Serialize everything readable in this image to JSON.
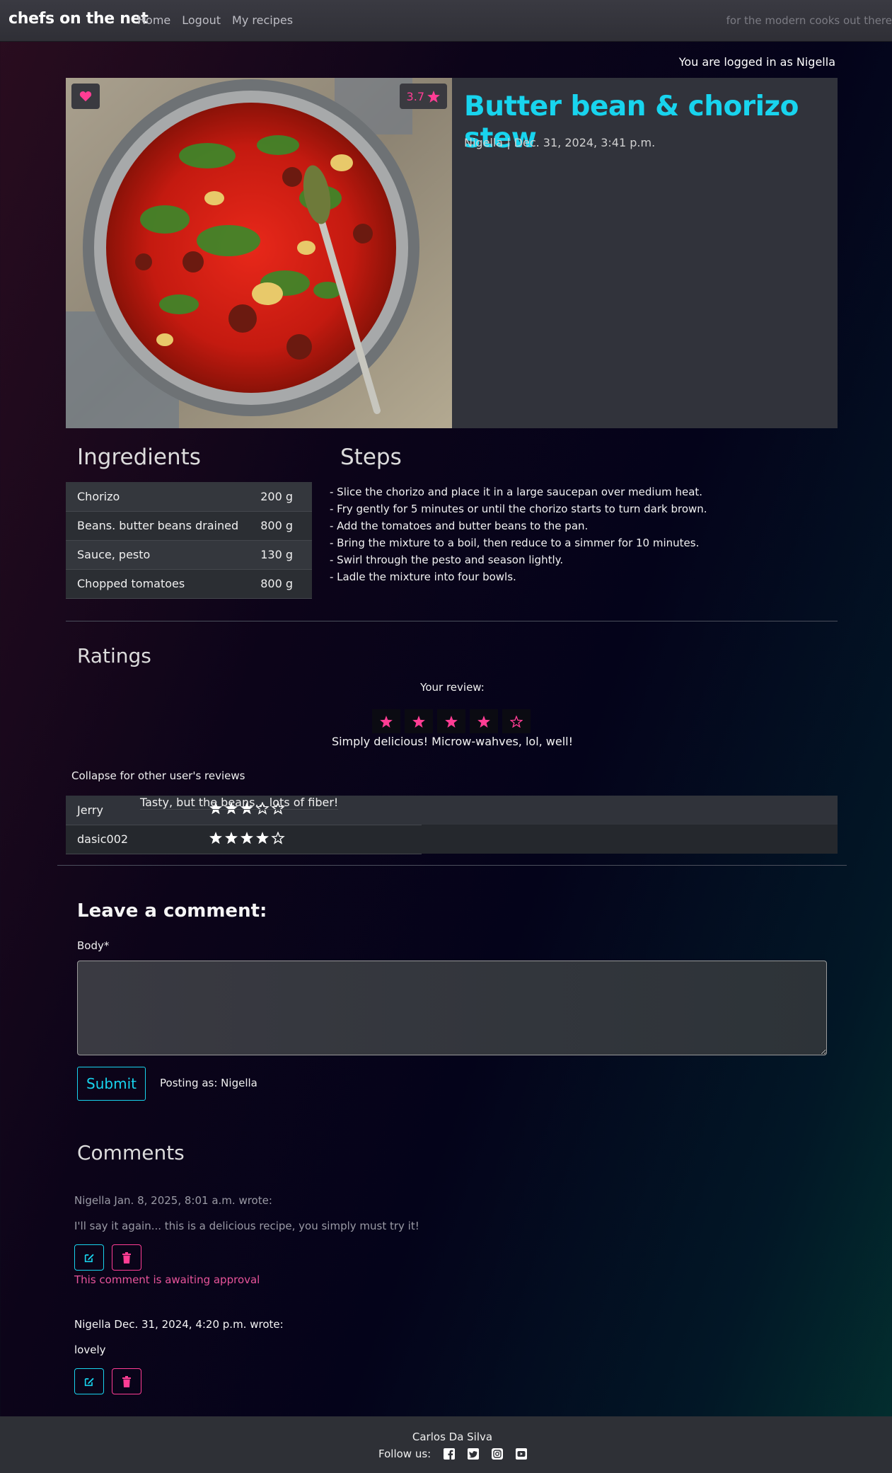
{
  "nav": {
    "brand": "chefs on the net",
    "links": [
      "Home",
      "Logout",
      "My recipes"
    ],
    "tagline": "for the modern cooks out there"
  },
  "session": {
    "logged_in_text": "You are logged in as Nigella"
  },
  "recipe": {
    "title": "Butter bean & chorizo stew",
    "meta": "Nigella | Dec. 31, 2024, 3:41 p.m.",
    "rating": "3.7",
    "image_icon": "heart-icon"
  },
  "ingredients": {
    "heading": "Ingredients",
    "items": [
      {
        "name": "Chorizo",
        "qty": "200 g"
      },
      {
        "name": "Beans. butter beans drained",
        "qty": "800 g"
      },
      {
        "name": "Sauce, pesto",
        "qty": "130 g"
      },
      {
        "name": "Chopped tomatoes",
        "qty": "800 g"
      }
    ]
  },
  "steps": {
    "heading": "Steps",
    "items": [
      "- Slice the chorizo and place it in a large saucepan over medium heat.",
      "- Fry gently for 5 minutes or until the chorizo starts to turn dark brown.",
      "- Add the tomatoes and butter beans to the pan.",
      "- Bring the mixture to a boil, then reduce to a simmer for 10 minutes.",
      "- Swirl through the pesto and season lightly.",
      "- Ladle the mixture into four bowls."
    ]
  },
  "ratings": {
    "heading": "Ratings",
    "your_review_label": "Your review:",
    "your_stars": 4,
    "your_review_text": "Simply delicious! Microw-wahves, lol, well!",
    "collapse_label": "Collapse for other user's reviews",
    "reviews": [
      {
        "user": "Jerry",
        "stars": 3,
        "comment": "Tasty, but the beans... lots of fiber!"
      },
      {
        "user": "dasic002",
        "stars": 4,
        "comment": ""
      }
    ]
  },
  "comment_form": {
    "heading": "Leave a comment:",
    "body_label": "Body*",
    "body_value": "",
    "submit_label": "Submit",
    "posting_as": "Posting as: Nigella"
  },
  "comments": {
    "heading": "Comments",
    "items": [
      {
        "header": "Nigella Jan. 8, 2025, 8:01 a.m. wrote:",
        "body": "I'll say it again... this is a delicious recipe, you simply must try it!",
        "pending": "This comment is awaiting approval"
      },
      {
        "header": "Nigella Dec. 31, 2024, 4:20 p.m. wrote:",
        "body": "lovely",
        "pending": ""
      }
    ]
  },
  "footer": {
    "author": "Carlos Da Silva",
    "follow_label": "Follow us:",
    "social_icons": [
      "facebook-icon",
      "twitter-icon",
      "instagram-icon",
      "youtube-icon"
    ]
  },
  "colors": {
    "accent_cyan": "#18d4ee",
    "accent_pink": "#ff3d94"
  }
}
